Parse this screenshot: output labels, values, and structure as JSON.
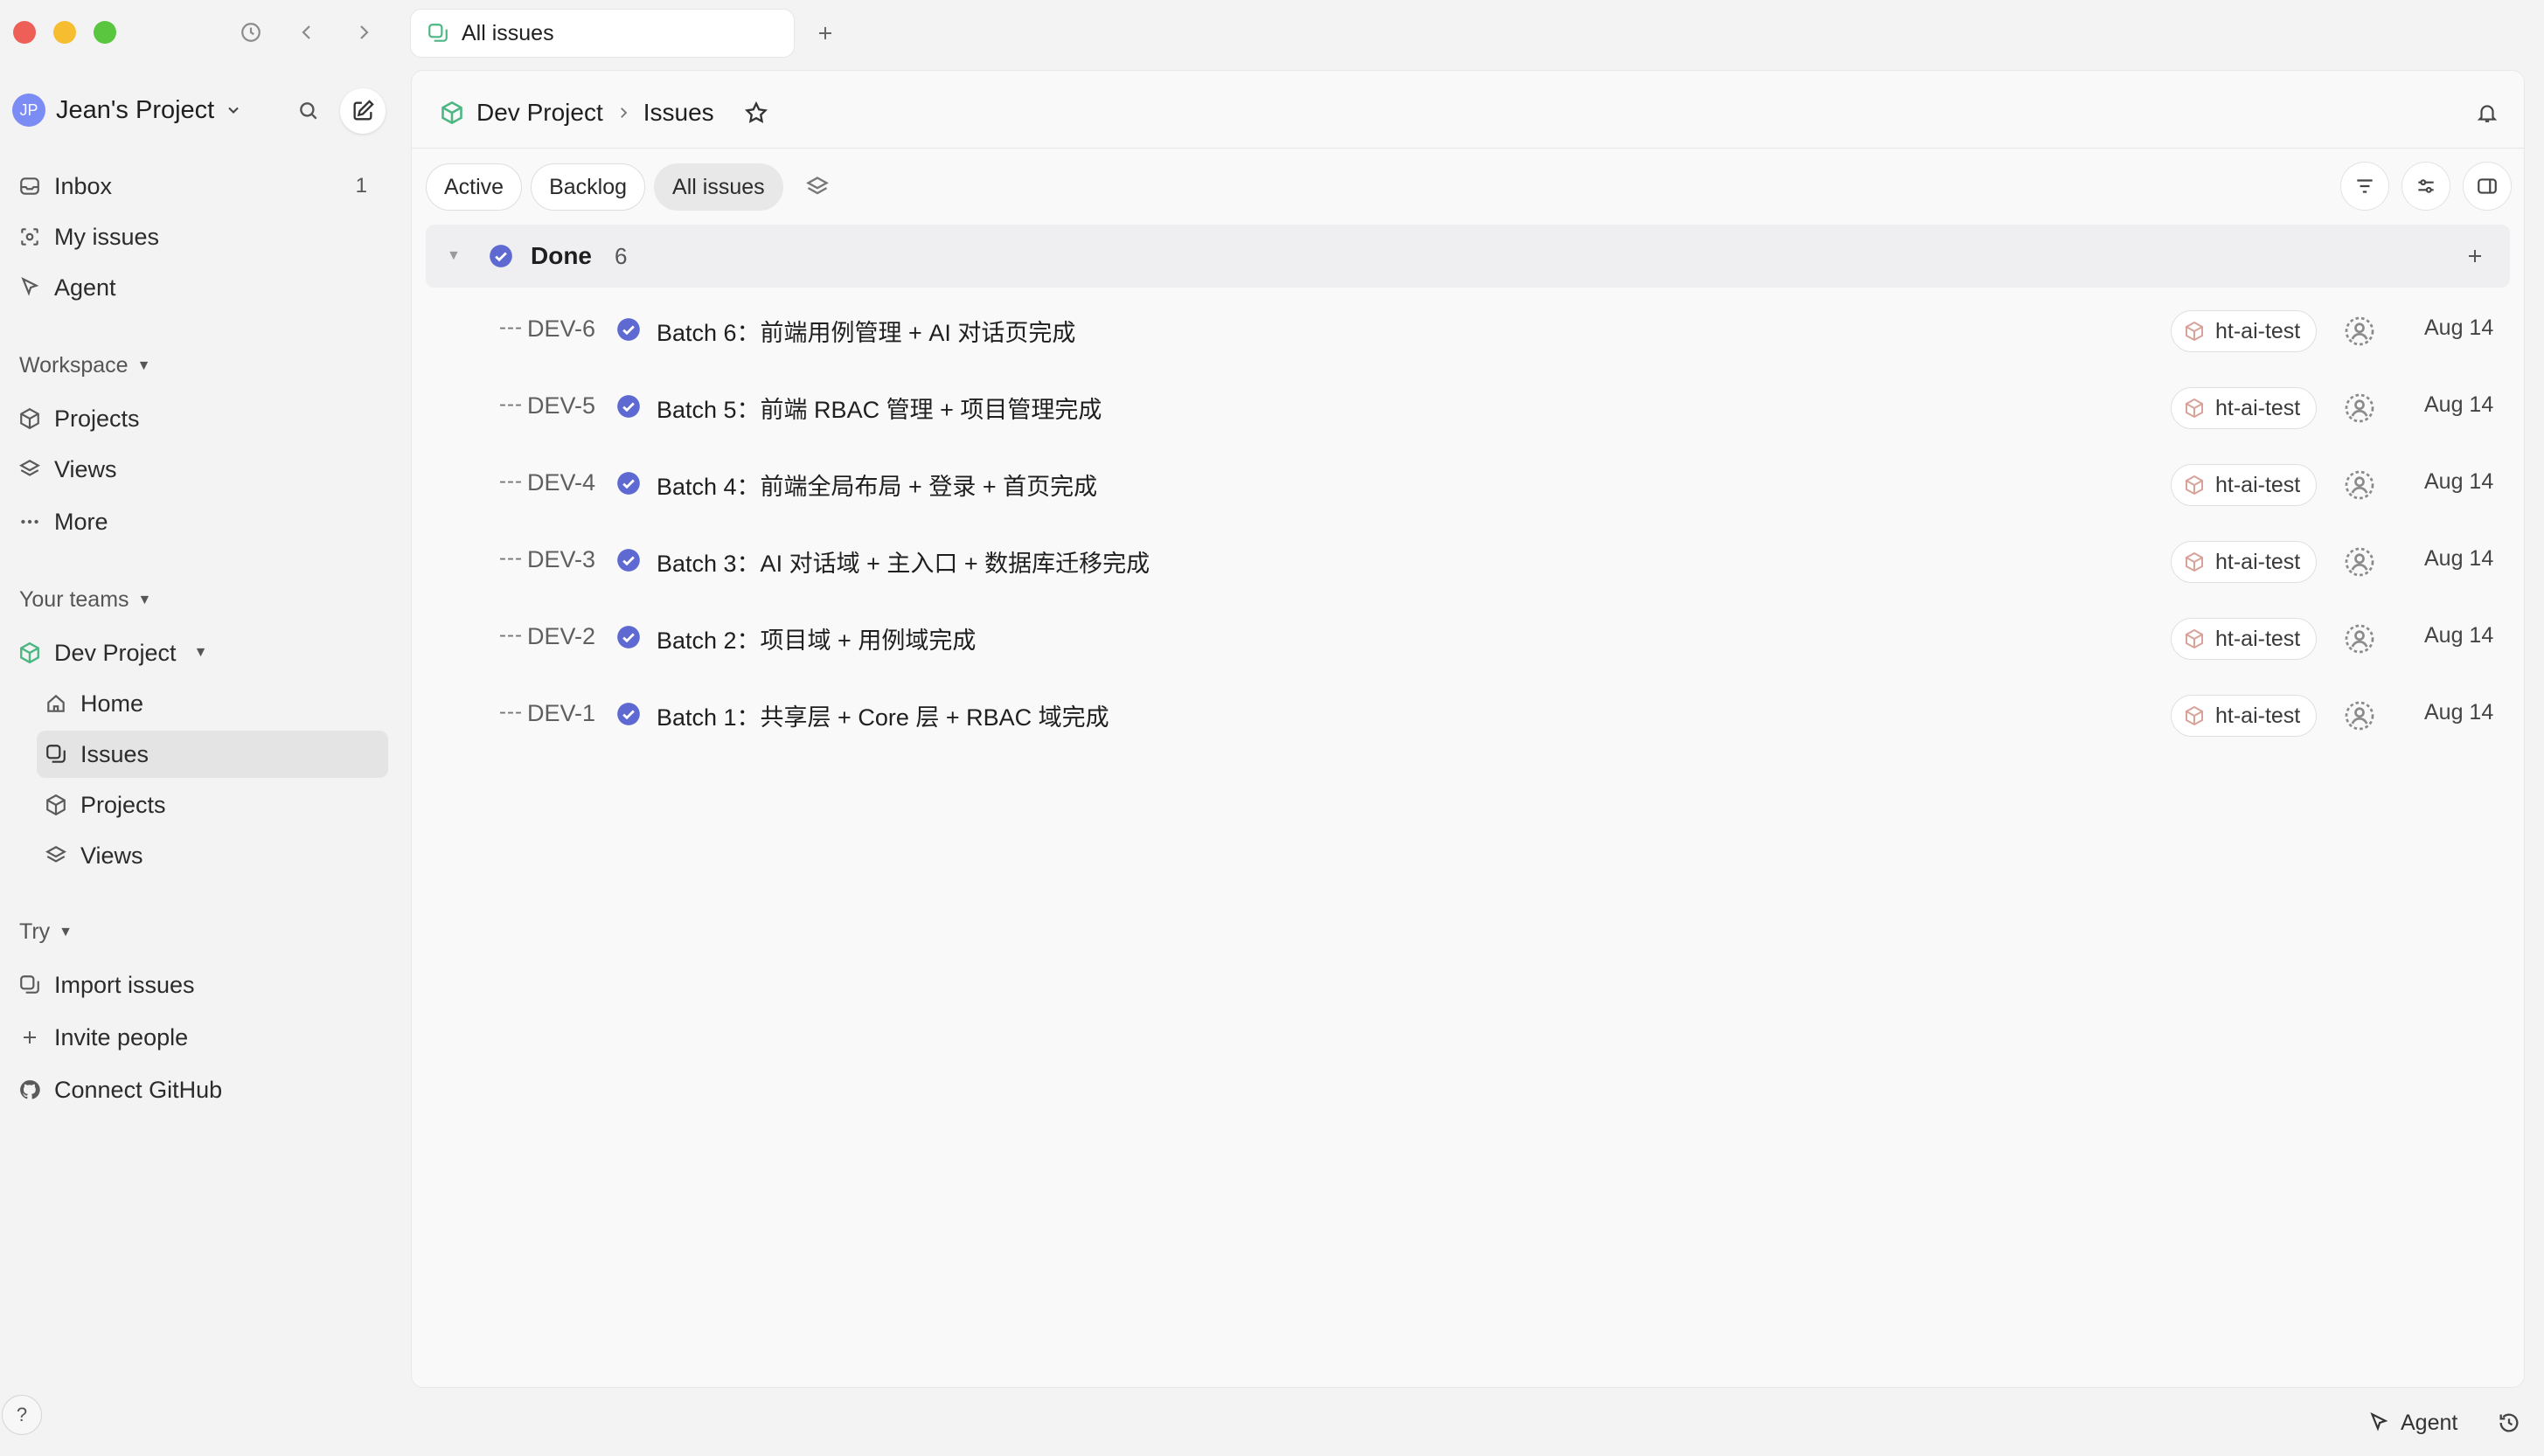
{
  "window": {
    "tab_title": "All issues"
  },
  "sidebar": {
    "workspace_initials": "JP",
    "workspace_name": "Jean's Project",
    "primary_nav": [
      {
        "label": "Inbox",
        "count": "1"
      },
      {
        "label": "My issues"
      },
      {
        "label": "Agent"
      }
    ],
    "workspace_section": {
      "title": "Workspace",
      "items": [
        {
          "label": "Projects"
        },
        {
          "label": "Views"
        },
        {
          "label": "More"
        }
      ]
    },
    "teams_section": {
      "title": "Your teams",
      "team_name": "Dev Project",
      "items": [
        {
          "label": "Home"
        },
        {
          "label": "Issues"
        },
        {
          "label": "Projects"
        },
        {
          "label": "Views"
        }
      ]
    },
    "try_section": {
      "title": "Try",
      "items": [
        {
          "label": "Import issues"
        },
        {
          "label": "Invite people"
        },
        {
          "label": "Connect GitHub"
        }
      ]
    },
    "help_label": "?"
  },
  "header": {
    "breadcrumb_project": "Dev Project",
    "breadcrumb_page": "Issues"
  },
  "view_tabs": [
    {
      "label": "Active"
    },
    {
      "label": "Backlog"
    },
    {
      "label": "All issues"
    }
  ],
  "group": {
    "title": "Done",
    "count": "6"
  },
  "issues": [
    {
      "id": "DEV-6",
      "dots": "---",
      "title": "Batch 6：前端用例管理 + AI 对话页完成",
      "project": "ht-ai-test",
      "date": "Aug 14"
    },
    {
      "id": "DEV-5",
      "dots": "---",
      "title": "Batch 5：前端 RBAC 管理 + 项目管理完成",
      "project": "ht-ai-test",
      "date": "Aug 14"
    },
    {
      "id": "DEV-4",
      "dots": "---",
      "title": "Batch 4：前端全局布局 + 登录 + 首页完成",
      "project": "ht-ai-test",
      "date": "Aug 14"
    },
    {
      "id": "DEV-3",
      "dots": "---",
      "title": "Batch 3：AI 对话域 + 主入口 + 数据库迁移完成",
      "project": "ht-ai-test",
      "date": "Aug 14"
    },
    {
      "id": "DEV-2",
      "dots": "---",
      "title": "Batch 2：项目域 + 用例域完成",
      "project": "ht-ai-test",
      "date": "Aug 14"
    },
    {
      "id": "DEV-1",
      "dots": "---",
      "title": "Batch 1：共享层 + Core 层 + RBAC 域完成",
      "project": "ht-ai-test",
      "date": "Aug 14"
    }
  ],
  "bottom_bar": {
    "agent_label": "Agent"
  },
  "colors": {
    "accent_done": "#5e6ad2",
    "team_icon": "#4cb782",
    "project_icon": "#d9a299"
  }
}
